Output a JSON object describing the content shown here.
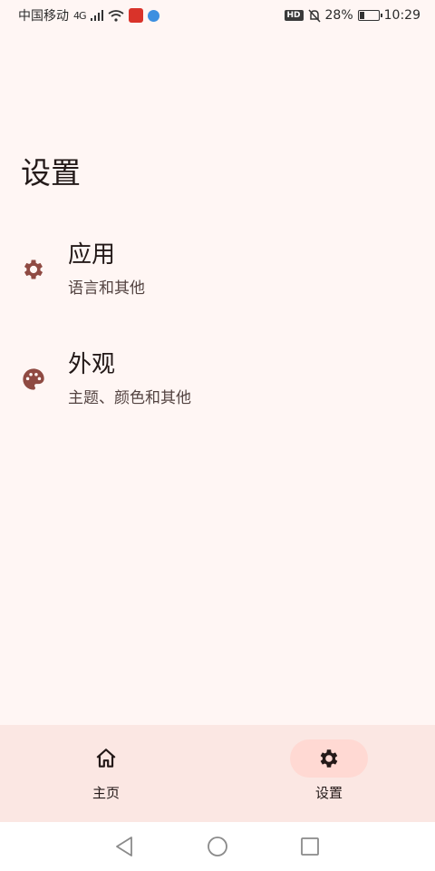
{
  "status_bar": {
    "carrier": "中国移动",
    "network": "4G",
    "battery_text": "28%",
    "battery_level": 0.28,
    "time": "10:29"
  },
  "page": {
    "title": "设置"
  },
  "settings": [
    {
      "icon": "gear-icon",
      "title": "应用",
      "subtitle": "语言和其他"
    },
    {
      "icon": "palette-icon",
      "title": "外观",
      "subtitle": "主题、颜色和其他"
    }
  ],
  "bottom_nav": {
    "items": [
      {
        "icon": "home-icon",
        "label": "主页",
        "active": false
      },
      {
        "icon": "gear-icon",
        "label": "设置",
        "active": true
      }
    ]
  },
  "colors": {
    "background": "#fff6f4",
    "icon_accent": "#8f4a42",
    "nav_background": "#fbe7e3",
    "active_pill": "#ffd9d3"
  }
}
